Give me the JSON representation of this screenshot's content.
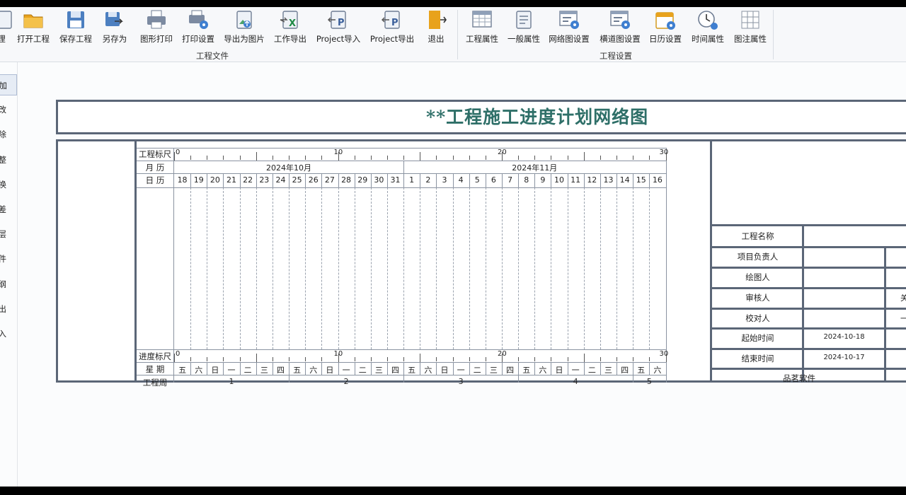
{
  "ribbon": {
    "buttons": [
      {
        "label": "理",
        "icon": "new-project-icon"
      },
      {
        "label": "打开工程",
        "icon": "open-folder-icon"
      },
      {
        "label": "保存工程",
        "icon": "save-icon"
      },
      {
        "label": "另存为",
        "icon": "save-as-icon"
      },
      {
        "label": "图形打印",
        "icon": "printer-icon"
      },
      {
        "label": "打印设置",
        "icon": "print-settings-icon"
      },
      {
        "label": "导出为图片",
        "icon": "export-image-icon"
      },
      {
        "label": "工作导出",
        "icon": "excel-export-icon"
      },
      {
        "label": "Project导入",
        "icon": "project-import-icon"
      },
      {
        "label": "Project导出",
        "icon": "project-export-icon"
      },
      {
        "label": "退出",
        "icon": "exit-icon"
      },
      {
        "label": "工程属性",
        "icon": "project-props-icon"
      },
      {
        "label": "一般属性",
        "icon": "general-props-icon"
      },
      {
        "label": "网络图设置",
        "icon": "network-settings-icon"
      },
      {
        "label": "横道图设置",
        "icon": "gantt-settings-icon"
      },
      {
        "label": "日历设置",
        "icon": "calendar-settings-icon"
      },
      {
        "label": "时间属性",
        "icon": "clock-icon"
      },
      {
        "label": "图注属性",
        "icon": "legend-props-icon"
      }
    ],
    "groups": {
      "file": "工程文件",
      "settings": "工程设置"
    }
  },
  "leftbar": {
    "items": [
      "添加",
      "修改",
      "删除",
      "调整",
      "转换",
      "时差",
      "形层",
      "组件",
      "大纲",
      "导出",
      "导入"
    ]
  },
  "chart": {
    "title": "**工程施工进度计划网络图",
    "rows": {
      "ruler": "工程标尺",
      "month": "月 历",
      "day": "日 历",
      "progress": "进度标尺",
      "weekday": "星 期",
      "week": "工程周"
    },
    "months": [
      "2024年10月",
      "2024年11月"
    ],
    "days": [
      "18",
      "19",
      "20",
      "21",
      "22",
      "23",
      "24",
      "25",
      "26",
      "27",
      "28",
      "29",
      "30",
      "31",
      "1",
      "2",
      "3",
      "4",
      "5",
      "6",
      "7",
      "8",
      "9",
      "10",
      "11",
      "12",
      "13",
      "14",
      "15",
      "16"
    ],
    "weekdays": [
      "五",
      "六",
      "日",
      "一",
      "二",
      "三",
      "四",
      "五",
      "六",
      "日",
      "一",
      "二",
      "三",
      "四",
      "五",
      "六",
      "日",
      "一",
      "二",
      "三",
      "四",
      "五",
      "六",
      "日",
      "一",
      "二",
      "三",
      "四",
      "五",
      "六"
    ],
    "scale_numbers": [
      "0",
      "10",
      "20",
      "30"
    ],
    "weeks": [
      "1",
      "2",
      "3",
      "4",
      "5"
    ]
  },
  "info": {
    "rows": [
      {
        "label": "工程名称",
        "value": ""
      },
      {
        "label": "项目负责人",
        "value": ""
      },
      {
        "label": "绘图人",
        "value": ""
      },
      {
        "label": "审核人",
        "value": ""
      },
      {
        "label": "校对人",
        "value": ""
      },
      {
        "label": "起始时间",
        "value": "2024-10-18"
      },
      {
        "label": "结束时间",
        "value": "2024-10-17"
      },
      {
        "label": "品茗软件",
        "value": ""
      }
    ],
    "extra": [
      "关",
      "一"
    ]
  },
  "colors": {
    "frame": "#5b6677",
    "title": "#2e6f68",
    "accent": "#e8a21c"
  }
}
